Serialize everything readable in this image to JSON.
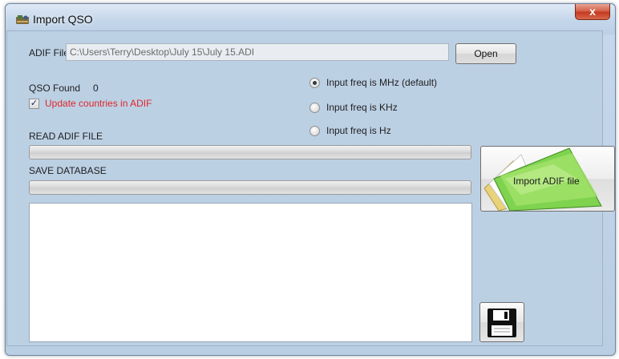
{
  "window": {
    "title": "Import QSO",
    "close_label": "x"
  },
  "adif": {
    "label": "ADIF File",
    "path": "C:\\Users\\Terry\\Desktop\\July 15\\July 15.ADI",
    "open_label": "Open"
  },
  "qso": {
    "found_label": "QSO Found",
    "found_count": "0"
  },
  "update_countries": {
    "label": "Update countries in ADIF",
    "checked": true,
    "color": "#e0262b"
  },
  "freq_options": [
    {
      "label": "Input freq is MHz (default)",
      "selected": true
    },
    {
      "label": "Input freq is KHz",
      "selected": false
    },
    {
      "label": "Input freq is Hz",
      "selected": false
    }
  ],
  "progress": {
    "read_label": "READ ADIF FILE",
    "read_value": 0,
    "save_label": "SAVE DATABASE",
    "save_value": 0
  },
  "log": {
    "text": ""
  },
  "import_button": {
    "label": "Import ADIF file",
    "icon": "green-folder-icon"
  },
  "save_button": {
    "icon": "floppy-disk-icon"
  },
  "colors": {
    "client_bg": "#bcd0e4",
    "accent_green": "#57c23a"
  }
}
